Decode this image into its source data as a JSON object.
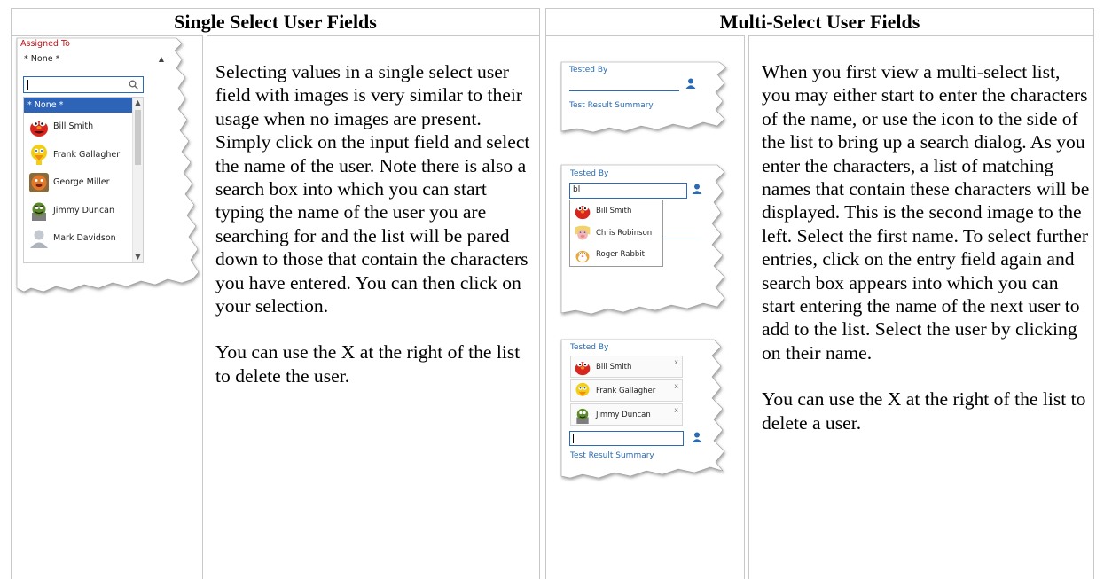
{
  "headers": {
    "left": "Single Select User Fields",
    "right": "Multi-Select User Fields"
  },
  "single": {
    "field_label": "Assigned To",
    "selected_value": "* None *",
    "search_value": "",
    "options": [
      "* None *",
      "Bill Smith",
      "Frank Gallagher",
      "George Miller",
      "Jimmy Duncan",
      "Mark Davidson"
    ],
    "text_p1": "Selecting values in a single select user field with images is very similar to their usage when no images are present.  Simply click on the input field and select the name of the user.  Note there is also a search box into which you can start typing the name of the user you are searching for and the list will be pared down to those that contain the characters you have entered.  You can then click on your selection.",
    "text_p2": "You can use the X at the right of the list to delete the user."
  },
  "multi": {
    "shot1": {
      "field_label": "Tested By",
      "next_label": "Test Result Summary"
    },
    "shot2": {
      "field_label": "Tested By",
      "search_value": "bl",
      "results": [
        "Bill Smith",
        "Chris Robinson",
        "Roger Rabbit"
      ]
    },
    "shot3": {
      "field_label": "Tested By",
      "chips": [
        "Bill Smith",
        "Frank Gallagher",
        "Jimmy Duncan"
      ],
      "remove_glyph": "x",
      "next_label": "Test Result Summary"
    },
    "text_p1": "When you first view a multi-select list, you may either start to enter the characters of the name, or use the icon to the side of the list to bring up a search dialog.  As you enter the characters, a list of matching names that contain these characters will be displayed.  This is the second image to the left.  Select the first name.  To select further entries, click on the entry field again and search box appears into which you can start entering the name of the next user to add to the list.  Select the user by clicking on their name.",
    "text_p2": "You can use the X at the right of the list to delete a user."
  },
  "colors": {
    "accent": "#2e64b8",
    "label_red": "#c0161b",
    "label_blue": "#2a6bb4"
  },
  "icons": [
    "magnifier-icon",
    "user-icon",
    "avatar-red-muppet",
    "avatar-yellow-bird",
    "avatar-orange-muppet",
    "avatar-green-grouch",
    "avatar-default-silhouette",
    "avatar-pig",
    "avatar-rabbit"
  ]
}
